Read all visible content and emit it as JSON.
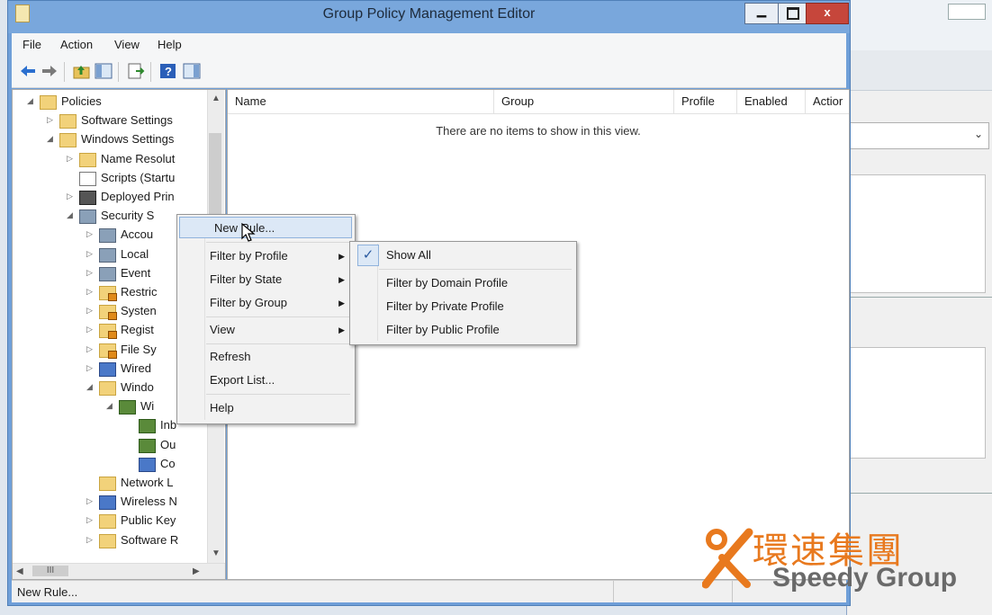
{
  "window": {
    "title": "Group Policy Management Editor",
    "min_glyph": "▁",
    "close_glyph": "x"
  },
  "menubar": {
    "items": [
      "File",
      "Action",
      "View",
      "Help"
    ]
  },
  "tree": {
    "nodes": [
      {
        "label": "Policies",
        "expander": "◢",
        "icon": "folder-icon"
      },
      {
        "label": "Software Settings",
        "expander": "▷",
        "icon": "folder-icon"
      },
      {
        "label": "Windows Settings",
        "expander": "◢",
        "icon": "folder-icon"
      },
      {
        "label": "Name Resolut",
        "expander": "▷",
        "icon": "folder-icon"
      },
      {
        "label": "Scripts (Startu",
        "expander": "",
        "icon": "scripts-icon"
      },
      {
        "label": "Deployed Prin",
        "expander": "▷",
        "icon": "printer-icon"
      },
      {
        "label": "Security S",
        "expander": "◢",
        "icon": "security-settings-icon"
      },
      {
        "label": "Accou",
        "expander": "▷",
        "icon": "policy-icon"
      },
      {
        "label": "Local",
        "expander": "▷",
        "icon": "policy-icon"
      },
      {
        "label": "Event",
        "expander": "▷",
        "icon": "policy-icon"
      },
      {
        "label": "Restric",
        "expander": "▷",
        "icon": "locked-folder-icon"
      },
      {
        "label": "Systen",
        "expander": "▷",
        "icon": "locked-folder-icon"
      },
      {
        "label": "Regist",
        "expander": "▷",
        "icon": "locked-folder-icon"
      },
      {
        "label": "File Sy",
        "expander": "▷",
        "icon": "locked-folder-icon"
      },
      {
        "label": "Wired",
        "expander": "▷",
        "icon": "network-policy-icon"
      },
      {
        "label": "Windo",
        "expander": "◢",
        "icon": "folder-icon"
      },
      {
        "label": "Wi",
        "expander": "◢",
        "icon": "firewall-icon"
      },
      {
        "label": "Inb",
        "expander": "",
        "icon": "inbound-rules-icon"
      },
      {
        "label": "Ou",
        "expander": "",
        "icon": "outbound-rules-icon"
      },
      {
        "label": "Co",
        "expander": "",
        "icon": "connection-security-icon"
      },
      {
        "label": "Network L",
        "expander": "",
        "icon": "folder-icon"
      },
      {
        "label": "Wireless N",
        "expander": "▷",
        "icon": "wireless-icon"
      },
      {
        "label": "Public Key",
        "expander": "▷",
        "icon": "folder-icon"
      },
      {
        "label": "Software R",
        "expander": "▷",
        "icon": "folder-icon"
      }
    ],
    "hscroll_thumb": "III"
  },
  "list": {
    "columns": [
      "Name",
      "Group",
      "Profile",
      "Enabled",
      "Actior"
    ],
    "empty_message": "There are no items to show in this view."
  },
  "statusbar": {
    "text": "New Rule..."
  },
  "context_menu": {
    "items": [
      "New Rule...",
      "Filter by Profile",
      "Filter by State",
      "Filter by Group",
      "View",
      "Refresh",
      "Export List...",
      "Help"
    ]
  },
  "submenu": {
    "check": "✓",
    "items": [
      "Show All",
      "Filter by Domain Profile",
      "Filter by Private Profile",
      "Filter by Public Profile"
    ]
  },
  "watermark": {
    "chinese": "環速集團",
    "english": "Speedy Group"
  },
  "colors": {
    "accent": "#e8791e",
    "titlebar": "#79a7dc",
    "close": "#c6463b"
  }
}
